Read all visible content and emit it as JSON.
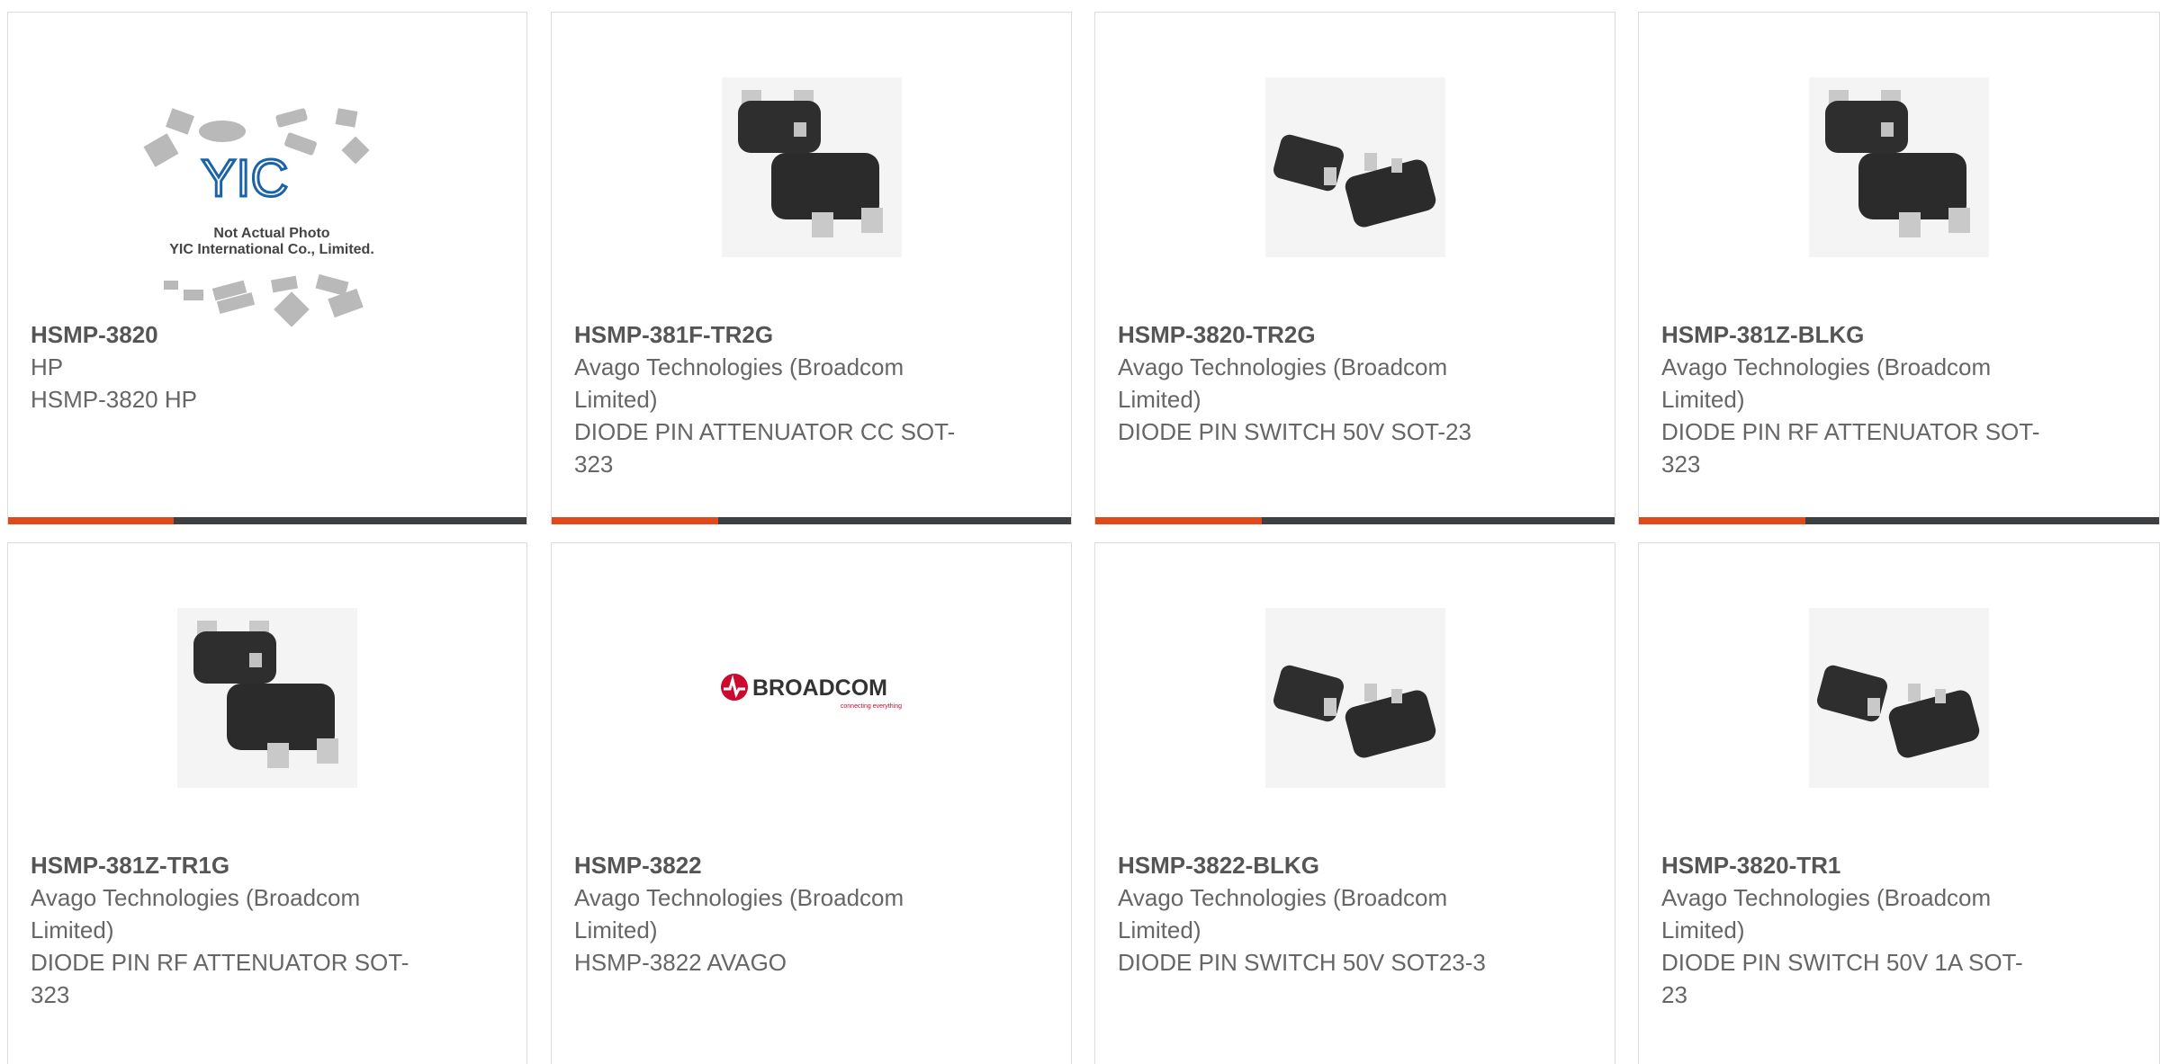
{
  "accent_color": "#e04a1a",
  "bar_color": "#3d3f41",
  "products": [
    {
      "part": "HSMP-3820",
      "mfr": "HP",
      "desc": "HSMP-3820 HP",
      "image": "yic-placeholder",
      "image_text": [
        "Not Actual Photo",
        "YIC International Co., Limited."
      ],
      "logo_text": "YIC"
    },
    {
      "part": "HSMP-381F-TR2G",
      "mfr": "Avago Technologies (Broadcom Limited)",
      "desc": "DIODE PIN ATTENUATOR CC SOT-323",
      "image": "sot323-package-photo"
    },
    {
      "part": "HSMP-3820-TR2G",
      "mfr": "Avago Technologies (Broadcom Limited)",
      "desc": "DIODE PIN SWITCH 50V SOT-23",
      "image": "sot23-package-photo"
    },
    {
      "part": "HSMP-381Z-BLKG",
      "mfr": "Avago Technologies (Broadcom Limited)",
      "desc": "DIODE PIN RF ATTENUATOR SOT-323",
      "image": "sot323-package-photo"
    },
    {
      "part": "HSMP-381Z-TR1G",
      "mfr": "Avago Technologies (Broadcom Limited)",
      "desc": "DIODE PIN RF ATTENUATOR SOT-323",
      "image": "sot323-package-photo"
    },
    {
      "part": "HSMP-3822",
      "mfr": "Avago Technologies (Broadcom Limited)",
      "desc": "HSMP-3822 AVAGO",
      "image": "broadcom-logo",
      "logo_text": "BROADCOM",
      "logo_tagline": "connecting everything"
    },
    {
      "part": "HSMP-3822-BLKG",
      "mfr": "Avago Technologies (Broadcom Limited)",
      "desc": "DIODE PIN SWITCH 50V SOT23-3",
      "image": "sot23-package-photo"
    },
    {
      "part": "HSMP-3820-TR1",
      "mfr": "Avago Technologies (Broadcom Limited)",
      "desc": "DIODE PIN SWITCH 50V 1A SOT-23",
      "image": "sot23-package-photo"
    }
  ]
}
